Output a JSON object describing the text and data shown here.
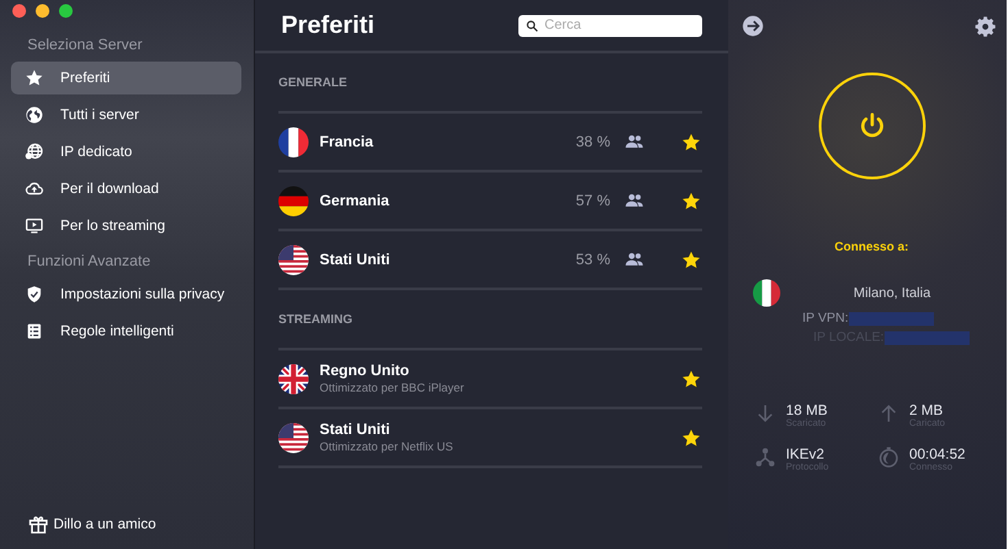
{
  "sidebar": {
    "sections": [
      {
        "title": "Seleziona Server",
        "items": [
          {
            "label": "Preferiti",
            "selected": true
          },
          {
            "label": "Tutti i server",
            "selected": false
          },
          {
            "label": "IP dedicato",
            "selected": false
          },
          {
            "label": "Per il download",
            "selected": false
          },
          {
            "label": "Per lo streaming",
            "selected": false
          }
        ]
      },
      {
        "title": "Funzioni Avanzate",
        "items": [
          {
            "label": "Impostazioni sulla privacy",
            "selected": false
          },
          {
            "label": "Regole intelligenti",
            "selected": false
          }
        ]
      }
    ],
    "footer": "Dillo a un amico"
  },
  "main": {
    "title": "Preferiti",
    "search": {
      "placeholder": "Cerca"
    },
    "groups": [
      {
        "title": "GENERALE",
        "rows": [
          {
            "name": "Francia",
            "load": "38 %",
            "favorite": true
          },
          {
            "name": "Germania",
            "load": "57 %",
            "favorite": true
          },
          {
            "name": "Stati Uniti",
            "load": "53 %",
            "favorite": true
          }
        ]
      },
      {
        "title": "STREAMING",
        "rows": [
          {
            "name": "Regno Unito",
            "subtitle": "Ottimizzato per BBC iPlayer",
            "favorite": true
          },
          {
            "name": "Stati Uniti",
            "subtitle": "Ottimizzato per Netflix US",
            "favorite": true
          }
        ]
      }
    ]
  },
  "connection": {
    "connected": true,
    "status": "Connesso a:",
    "location": "Milano, Italia",
    "vpn_ip_label": "IP VPN:",
    "local_ip_label": "IP LOCALE:",
    "stats": [
      {
        "value": "18 MB",
        "label": "Scaricato"
      },
      {
        "value": "2 MB",
        "label": "Caricato"
      },
      {
        "value": "IKEv2",
        "label": "Protocollo"
      },
      {
        "value": "00:04:52",
        "label": "Connesso"
      }
    ]
  }
}
